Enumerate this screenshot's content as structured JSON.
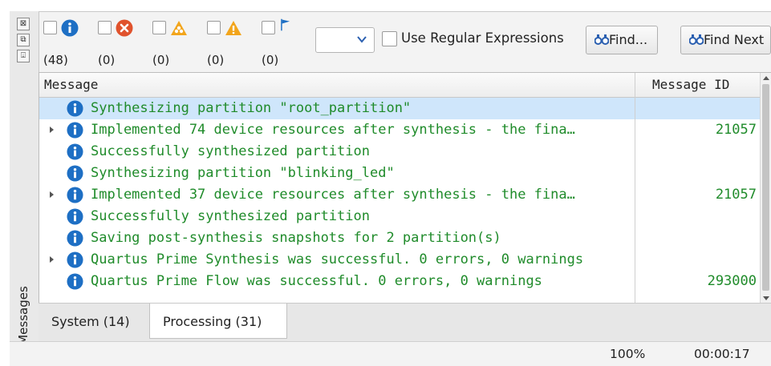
{
  "side": {
    "close_glyph": "⊠",
    "float_glyph": "⧉",
    "pin_glyph": "⍗",
    "title": "Messages"
  },
  "filters": [
    {
      "icon": "info-icon",
      "count": "(48)"
    },
    {
      "icon": "error-icon",
      "count": "(0)"
    },
    {
      "icon": "critical-warning-icon",
      "count": "(0)"
    },
    {
      "icon": "warning-icon",
      "count": "(0)"
    },
    {
      "icon": "flag-icon",
      "count": "(0)"
    }
  ],
  "search": {
    "value": "",
    "regex_label": "Use Regular Expressions"
  },
  "buttons": {
    "find": "Find...",
    "find_next": "Find Next"
  },
  "table": {
    "headers": {
      "message": "Message",
      "message_id": "Message ID"
    },
    "rows": [
      {
        "expandable": false,
        "text": "Synthesizing partition \"root_partition\"",
        "id": "",
        "selected": true
      },
      {
        "expandable": true,
        "text": "Implemented 74 device resources after synthesis - the fina…",
        "id": "21057",
        "selected": false
      },
      {
        "expandable": false,
        "text": "Successfully synthesized partition",
        "id": "",
        "selected": false
      },
      {
        "expandable": false,
        "text": "Synthesizing partition \"blinking_led\"",
        "id": "",
        "selected": false
      },
      {
        "expandable": true,
        "text": "Implemented 37 device resources after synthesis - the fina…",
        "id": "21057",
        "selected": false
      },
      {
        "expandable": false,
        "text": "Successfully synthesized partition",
        "id": "",
        "selected": false
      },
      {
        "expandable": false,
        "text": "Saving post-synthesis snapshots for 2 partition(s)",
        "id": "",
        "selected": false
      },
      {
        "expandable": true,
        "text": "Quartus Prime Synthesis was successful. 0 errors, 0 warnings",
        "id": "",
        "selected": false
      },
      {
        "expandable": false,
        "text": "Quartus Prime Flow was successful. 0 errors, 0 warnings",
        "id": "293000",
        "selected": false
      }
    ]
  },
  "tabs": [
    {
      "label": "System (14)",
      "active": false
    },
    {
      "label": "Processing (31)",
      "active": true
    }
  ],
  "status": {
    "zoom": "100%",
    "elapsed": "00:00:17"
  },
  "colors": {
    "info": "#1e6fc4",
    "message_text": "#1f8b2a",
    "error": "#e0522c",
    "warning": "#f2a51c",
    "selection": "#cfe6fb"
  }
}
